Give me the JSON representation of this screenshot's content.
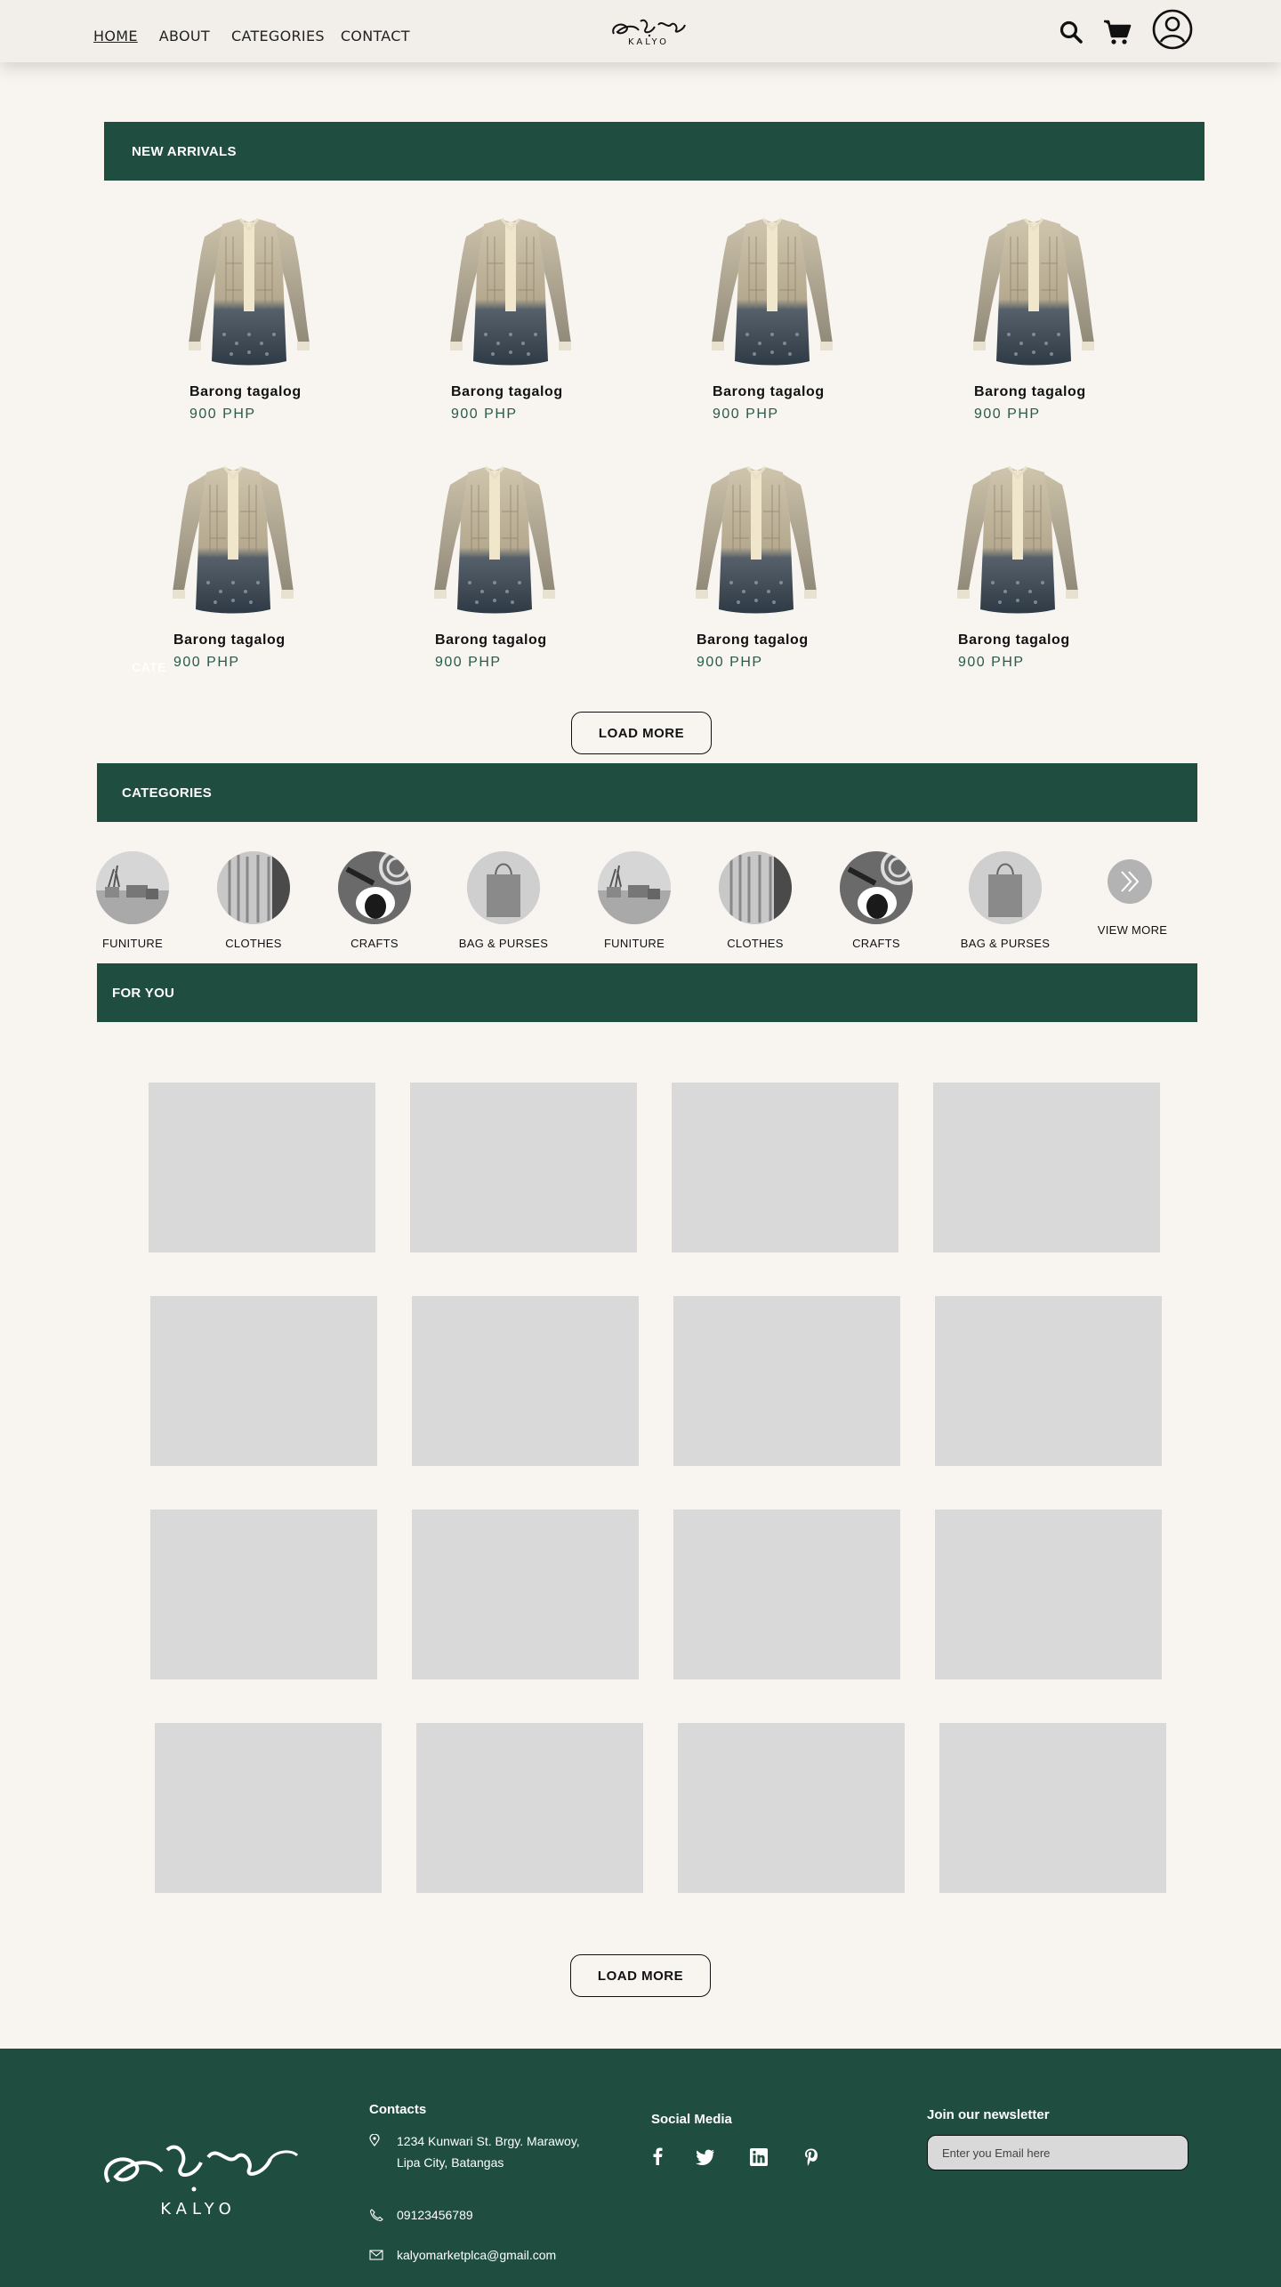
{
  "header": {
    "nav": [
      "HOME",
      "ABOUT",
      "CATEGORIES",
      "CONTACT"
    ],
    "logo_text": "KALYO"
  },
  "new_arrivals": {
    "title": "NEW ARRIVALS",
    "products": [
      {
        "name": "Barong tagalog",
        "price": "900 PHP"
      },
      {
        "name": "Barong tagalog",
        "price": "900 PHP"
      },
      {
        "name": "Barong tagalog",
        "price": "900 PHP"
      },
      {
        "name": "Barong tagalog",
        "price": "900 PHP"
      },
      {
        "name": "Barong tagalog",
        "price": "900 PHP"
      },
      {
        "name": "Barong tagalog",
        "price": "900 PHP"
      },
      {
        "name": "Barong tagalog",
        "price": "900 PHP"
      },
      {
        "name": "Barong tagalog",
        "price": "900 PHP"
      }
    ],
    "load_more": "LOAD MORE"
  },
  "categories": {
    "title": "CATEGORIES",
    "items": [
      {
        "label": "FUNITURE",
        "icon": "furniture"
      },
      {
        "label": "CLOTHES",
        "icon": "clothes"
      },
      {
        "label": "CRAFTS",
        "icon": "crafts"
      },
      {
        "label": "BAG & PURSES",
        "icon": "bag"
      },
      {
        "label": "FUNITURE",
        "icon": "furniture"
      },
      {
        "label": "CLOTHES",
        "icon": "clothes"
      },
      {
        "label": "CRAFTS",
        "icon": "crafts"
      },
      {
        "label": "BAG & PURSES",
        "icon": "bag"
      }
    ],
    "view_more": "VIEW MORE"
  },
  "for_you": {
    "title": "FOR YOU",
    "load_more": "LOAD MORE"
  },
  "footer": {
    "logo_text": "KALYO",
    "contacts_title": "Contacts",
    "address_line1": "1234 Kunwari St. Brgy. Marawoy,",
    "address_line2": "Lipa City, Batangas",
    "phone": "09123456789",
    "email": "kalyomarketplca@gmail.com",
    "social_title": "Social Media",
    "social": [
      "facebook-icon",
      "twitter-icon",
      "linkedin-icon",
      "pinterest-icon"
    ],
    "newsletter_title": "Join our newsletter",
    "newsletter_placeholder": "Enter you Email here"
  },
  "colors": {
    "brand_green": "#1f4d3f",
    "background": "#f8f5f0",
    "placeholder_gray": "#d9d9d9"
  }
}
